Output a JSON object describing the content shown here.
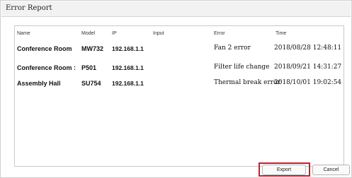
{
  "window": {
    "title": "Error Report"
  },
  "table": {
    "headers": {
      "name": "Name",
      "model": "Model",
      "ip": "IP",
      "input": "Input",
      "error": "Error",
      "time": "Time"
    },
    "rows": [
      {
        "name": "Conference Room",
        "model": "MW732",
        "ip": "192.168.1.1",
        "input": "",
        "error": "Fan 2 error",
        "time": "2018/08/28 12:48:11"
      },
      {
        "name": "Conference Room :",
        "model": "P501",
        "ip": "192.168.1.1",
        "input": "",
        "error": "Filter life change",
        "time": "2018/09/21 14:31:27"
      },
      {
        "name": "Assembly Hall",
        "model": "SU754",
        "ip": "192.168.1.1",
        "input": "",
        "error": "Thermal break error",
        "time": "2018/10/01 19:02:54"
      }
    ]
  },
  "buttons": {
    "export": "Export",
    "cancel": "Cancel"
  },
  "colors": {
    "highlight": "#e0141e"
  }
}
